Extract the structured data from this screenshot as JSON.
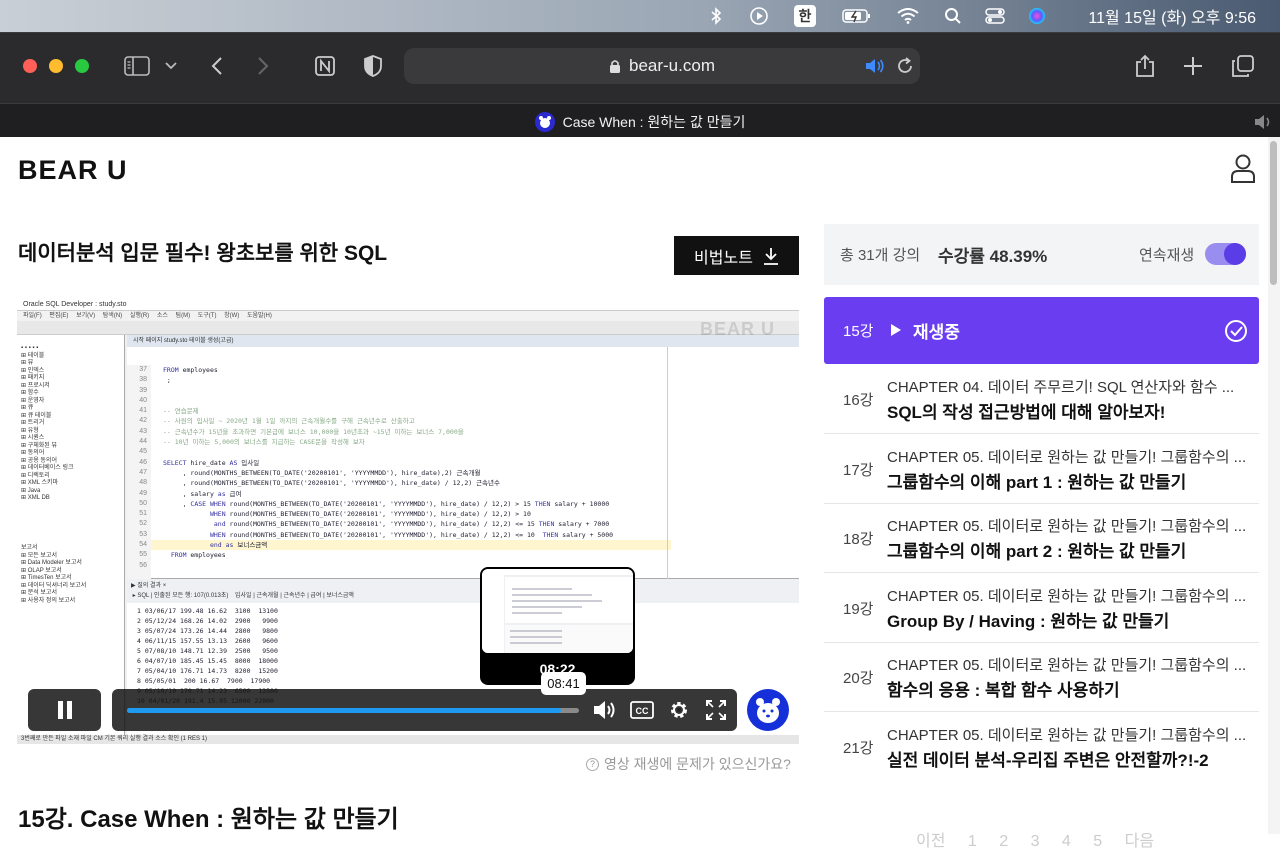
{
  "menubar": {
    "input_method": "한",
    "clock": "11월 15일 (화) 오후  9:56"
  },
  "browser": {
    "url": "bear-u.com",
    "tab_title": "Case When : 원하는 값 만들기"
  },
  "site": {
    "logo": "BEAR U"
  },
  "course": {
    "title": "데이터분석 입문 필수!  왕초보를 위한 SQL",
    "note_button": "비법노트"
  },
  "player": {
    "preview_time": "08:22",
    "current_time_tip": "08:41",
    "progress": 0.96,
    "help_text": "영상 재생에 문제가 있으신가요?",
    "screen_app_title": "Oracle SQL Developer : study.sto",
    "screen_menu": "파일(F) 편집(E) 보기(V) 탐색(N) 실행(R) 소스 팀(M) 도구(T) 창(W) 도움말(H)",
    "screen_tabs": "시작 페이지   study.sto   테이블 생성(고급)",
    "screen_watermark": "BEAR U",
    "screen_status": "3번째로 만든 파일 소재 파일 CM 기본 쿼리 실행 결과 소스 확인 (1 RES 1)"
  },
  "lesson": {
    "title": "15강. Case When : 원하는 값 만들기"
  },
  "pager": {
    "text": "이전 1 2 3 4 5 다음"
  },
  "summary": {
    "total": "총 31개 강의",
    "progress": "수강률 48.39%",
    "autoplay": "연속재생",
    "autoplay_on": true
  },
  "current_lesson": {
    "num": "15강",
    "label": "재생중"
  },
  "lessons": [
    {
      "num": "16강",
      "chapter": "CHAPTER 04. 데이터 주무르기! SQL 연산자와 함수 ...",
      "title": "SQL의 작성 접근방법에 대해 알아보자!"
    },
    {
      "num": "17강",
      "chapter": "CHAPTER 05. 데이터로 원하는 값 만들기! 그룹함수의 ...",
      "title": "그룹함수의 이해 part 1 : 원하는 값 만들기"
    },
    {
      "num": "18강",
      "chapter": "CHAPTER 05. 데이터로 원하는 값 만들기! 그룹함수의 ...",
      "title": "그룹함수의 이해 part 2 : 원하는 값 만들기"
    },
    {
      "num": "19강",
      "chapter": "CHAPTER 05. 데이터로 원하는 값 만들기! 그룹함수의 ...",
      "title": "Group By / Having : 원하는 값 만들기"
    },
    {
      "num": "20강",
      "chapter": "CHAPTER 05. 데이터로 원하는 값 만들기! 그룹함수의 ...",
      "title": "함수의 응용 : 복합 함수 사용하기"
    },
    {
      "num": "21강",
      "chapter": "CHAPTER 05. 데이터로 원하는 값 만들기! 그룹함수의 ...",
      "title": "실전 데이터 분석-우리집 주변은 안전할까?!-2"
    }
  ]
}
